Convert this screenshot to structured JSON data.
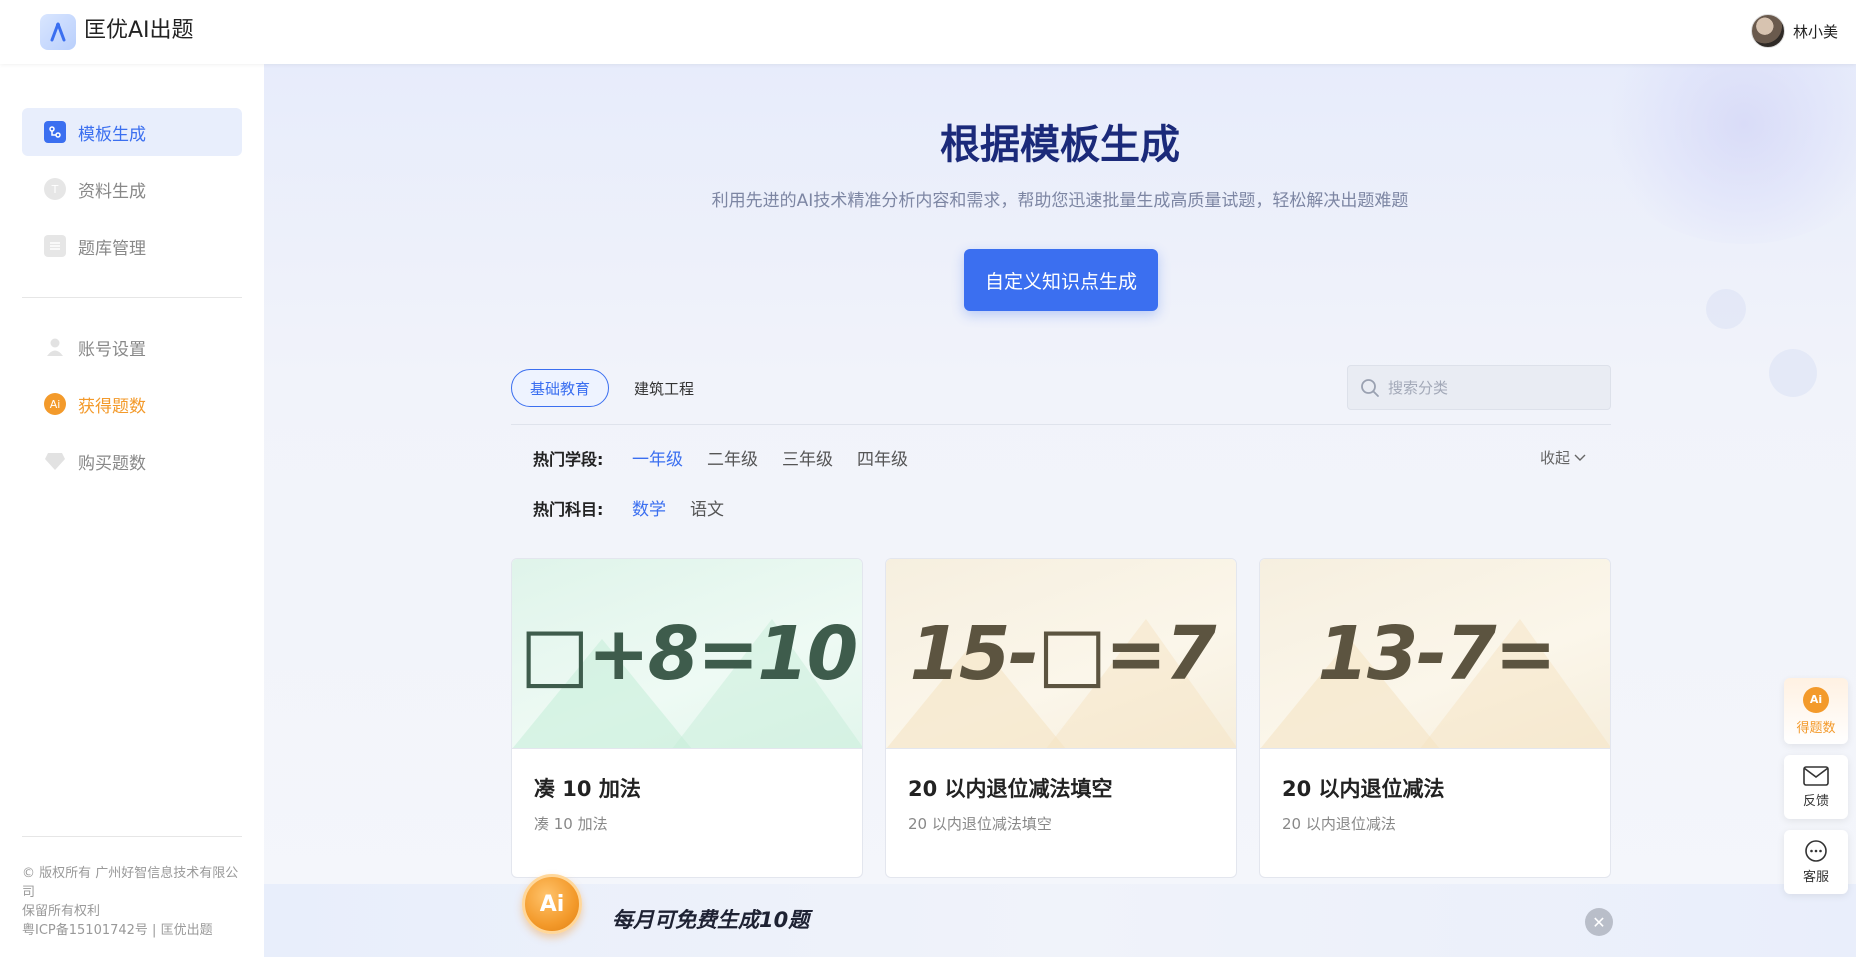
{
  "app": {
    "title": "匡优AI出题"
  },
  "user": {
    "name": "林小美"
  },
  "sidebar": {
    "items": [
      {
        "label": "模板生成"
      },
      {
        "label": "资料生成"
      },
      {
        "label": "题库管理"
      },
      {
        "label": "账号设置"
      },
      {
        "label": "获得题数"
      },
      {
        "label": "购买题数"
      }
    ],
    "footer": {
      "line1": "© 版权所有 广州好智信息技术有限公司",
      "line2": "保留所有权利",
      "line3": "粤ICP备15101742号 | 匡优出题"
    }
  },
  "main": {
    "title": "根据模板生成",
    "subtitle": "利用先进的AI技术精准分析内容和需求，帮助您迅速批量生成高质量试题，轻松解决出题难题",
    "cta_label": "自定义知识点生成",
    "tabs": [
      {
        "label": "基础教育"
      },
      {
        "label": "建筑工程"
      }
    ],
    "search": {
      "placeholder": "搜索分类"
    },
    "filters": {
      "grade_label": "热门学段:",
      "grades": [
        "一年级",
        "二年级",
        "三年级",
        "四年级"
      ],
      "subject_label": "热门科目:",
      "subjects": [
        "数学",
        "语文"
      ],
      "collapse_label": "收起"
    },
    "cards": [
      {
        "formula": "□+8=10",
        "title": "凑 10 加法",
        "desc": "凑 10 加法"
      },
      {
        "formula": "15-□=7",
        "title": "20 以内退位减法填空",
        "desc": "20 以内退位减法填空"
      },
      {
        "formula": "13-7=",
        "title": "20 以内退位减法",
        "desc": "20 以内退位减法"
      }
    ],
    "banner": {
      "coin_label": "Ai",
      "text": "每月可免费生成10题"
    }
  },
  "float": {
    "get_label": "得题数",
    "feedback_label": "反馈",
    "service_label": "客服"
  },
  "colors": {
    "accent": "#3b6ff0",
    "orange": "#f39a2b",
    "title": "#1b2a7a"
  }
}
